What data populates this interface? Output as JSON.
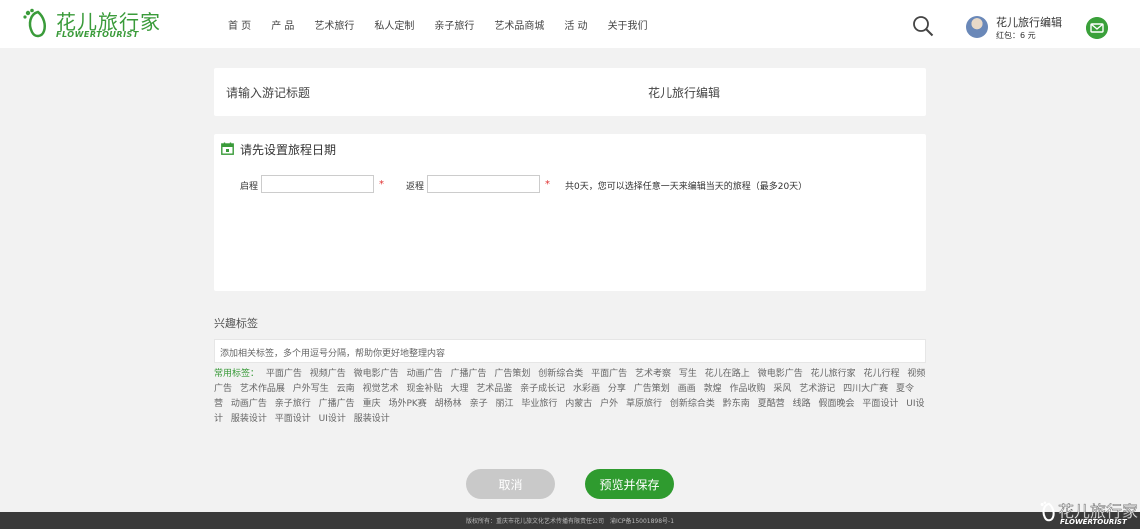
{
  "brand": {
    "name_cn": "花儿旅行家",
    "name_en": "FLOWERTOURIST"
  },
  "nav": [
    "首 页",
    "产 品",
    "艺术旅行",
    "私人定制",
    "亲子旅行",
    "艺术品商城",
    "活 动",
    "关于我们"
  ],
  "user": {
    "name": "花儿旅行编辑",
    "red_packet": "红包：6 元"
  },
  "title_card": {
    "title_placeholder": "请输入游记标题",
    "author": "花儿旅行编辑"
  },
  "date_card": {
    "heading": "请先设置旅程日期",
    "start_label": "启程",
    "return_label": "返程",
    "required_mark": "*",
    "note": "共0天，您可以选择任意一天来编辑当天的旅程（最多20天）"
  },
  "tags": {
    "title": "兴趣标签",
    "placeholder": "添加相关标签，多个用逗号分隔，帮助你更好地整理内容",
    "common_label": "常用标签：",
    "common": [
      "平面广告",
      "视频广告",
      "微电影广告",
      "动画广告",
      "广播广告",
      "广告策划",
      "创新综合类",
      "平面广告",
      "艺术考察",
      "写生",
      "花儿在路上",
      "微电影广告",
      "花儿旅行家",
      "花儿行程",
      "视频广告",
      "艺术作品展",
      "户外写生",
      "云南",
      "视觉艺术",
      "现金补贴",
      "大理",
      "艺术品鉴",
      "亲子成长记",
      "水彩画",
      "分享",
      "广告策划",
      "画画",
      "敦煌",
      "作品收购",
      "采风",
      "艺术游记",
      "四川大广赛",
      "夏令营",
      "动画广告",
      "亲子旅行",
      "广播广告",
      "重庆",
      "场外PK赛",
      "胡杨林",
      "亲子",
      "丽江",
      "毕业旅行",
      "内蒙古",
      "户外",
      "草原旅行",
      "创新综合类",
      "黔东南",
      "夏酷营",
      "线路",
      "假面晚会",
      "平面设计",
      "UI设计",
      "服装设计",
      "平面设计",
      "UI设计",
      "服装设计"
    ]
  },
  "buttons": {
    "cancel": "取消",
    "save": "预览并保存"
  },
  "footer": {
    "text": "版权所有：重庆市花儿旅文化艺术传播有限责任公司　渝ICP备15001898号-1"
  },
  "colors": {
    "brand_green": "#3a9b3a",
    "save_green": "#2f9b2f",
    "cancel_gray": "#c9c9c9",
    "required_red": "#e03030"
  }
}
